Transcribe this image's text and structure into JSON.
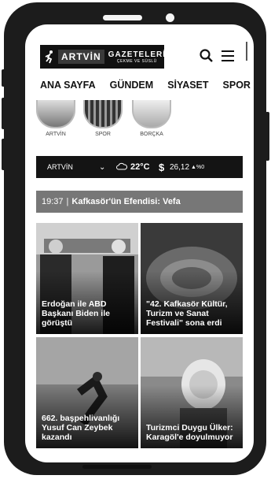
{
  "header": {
    "logo_name": "ARTVİN",
    "logo_title": "GAZETELERİ",
    "logo_tagline": "ÇEKME VE SÜSLÜ"
  },
  "nav": [
    "ANA SAYFA",
    "GÜNDEM",
    "SİYASET",
    "SPOR"
  ],
  "stories": [
    "ARTVİN",
    "SPOR",
    "BORÇKA"
  ],
  "weather": {
    "city": "ARTVİN",
    "temperature": "22°C",
    "currency_symbol": "$",
    "rate": "26,12",
    "change": "%0"
  },
  "ticker": {
    "time": "19:37",
    "separator": "|",
    "headline": "Kafkasör'ün Efendisi: Vefa"
  },
  "news": [
    {
      "title": "Erdoğan ile ABD Başkanı Biden ile görüştü"
    },
    {
      "title": "\"42. Kafkasör Kültür, Turizm ve Sanat Festivali\" sona erdi"
    },
    {
      "title": "662. başpehlivanlığı Yusuf Can Zeybek kazandı"
    },
    {
      "title": "Turizmci Duygu Ülker: Karagöl'e doyulmuyor"
    }
  ]
}
